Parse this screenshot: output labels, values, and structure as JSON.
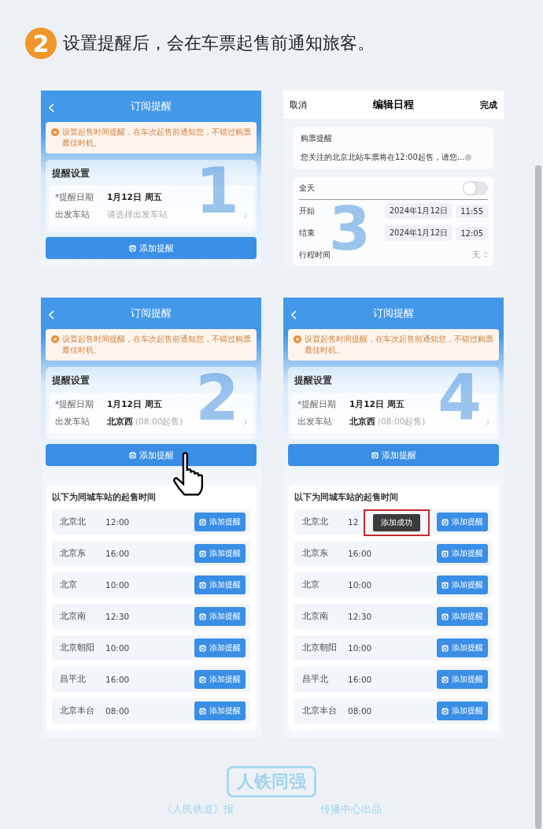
{
  "heading": {
    "step": "2",
    "text": "设置提醒后，会在车票起售前通知旅客。"
  },
  "panels": [
    {
      "kind": "subscribe",
      "number": "1",
      "title": "订阅提醒",
      "notice": "设置起售时间提醒，在车次起售前通知您，不错过购票最佳时机。",
      "section_title": "提醒设置",
      "date_label": "*提醒日期",
      "date_value": "1月12日 周五",
      "station_label": "出发车站",
      "station_placeholder": "请选择出发车站",
      "button": "添加提醒",
      "pointer": false
    },
    {
      "kind": "schedule",
      "number": "3",
      "cancel": "取消",
      "title": "编辑日程",
      "done": "完成",
      "event_title": "购票提醒",
      "event_note": "您关注的北京北站车票将在12:00起售，请您…",
      "all_day_label": "全天",
      "all_day": false,
      "start_label": "开始",
      "start_date": "2024年1月12日",
      "start_time": "11:55",
      "end_label": "结束",
      "end_date": "2024年1月12日",
      "end_time": "12:05",
      "travel_label": "行程时间",
      "travel_value": "无"
    },
    {
      "kind": "subscribe",
      "number": "2",
      "title": "订阅提醒",
      "notice": "设置起售时间提醒，在车次起售前通知您，不错过购票最佳时机。",
      "section_title": "提醒设置",
      "date_label": "*提醒日期",
      "date_value": "1月12日 周五",
      "station_label": "出发车站",
      "station_value": "北京西",
      "station_note": "(08:00起售)",
      "button": "添加提醒",
      "pointer": true,
      "list_title": "以下为同城车站的起售时间",
      "stations": [
        {
          "name": "北京北",
          "time": "12:00",
          "button": "添加提醒"
        },
        {
          "name": "北京东",
          "time": "16:00",
          "button": "添加提醒"
        },
        {
          "name": "北京",
          "time": "10:00",
          "button": "添加提醒"
        },
        {
          "name": "北京南",
          "time": "12:30",
          "button": "添加提醒"
        },
        {
          "name": "北京朝阳",
          "time": "10:00",
          "button": "添加提醒"
        },
        {
          "name": "昌平北",
          "time": "16:00",
          "button": "添加提醒"
        },
        {
          "name": "北京丰台",
          "time": "08:00",
          "button": "添加提醒"
        }
      ]
    },
    {
      "kind": "subscribe",
      "number": "4",
      "title": "订阅提醒",
      "notice": "设置起售时间提醒，在车次起售前通知您，不错过购票最佳时机。",
      "section_title": "提醒设置",
      "date_label": "*提醒日期",
      "date_value": "1月12日 周五",
      "station_label": "出发车站",
      "station_value": "北京西",
      "station_note": "(08:00起售)",
      "button": "添加提醒",
      "pointer": false,
      "list_title": "以下为同城车站的起售时间",
      "stations": [
        {
          "name": "北京北",
          "time": "12",
          "button": "添加提醒",
          "toast": "添加成功"
        },
        {
          "name": "北京东",
          "time": "16:00",
          "button": "添加提醒"
        },
        {
          "name": "北京",
          "time": "10:00",
          "button": "添加提醒"
        },
        {
          "name": "北京南",
          "time": "12:30",
          "button": "添加提醒"
        },
        {
          "name": "北京朝阳",
          "time": "10:00",
          "button": "添加提醒"
        },
        {
          "name": "昌平北",
          "time": "16:00",
          "button": "添加提醒"
        },
        {
          "name": "北京丰台",
          "time": "08:00",
          "button": "添加提醒"
        }
      ]
    }
  ],
  "footer": {
    "logo": "人铁同强",
    "credit_start": "《人民铁道》报",
    "credit_end": "传播中心出品"
  }
}
